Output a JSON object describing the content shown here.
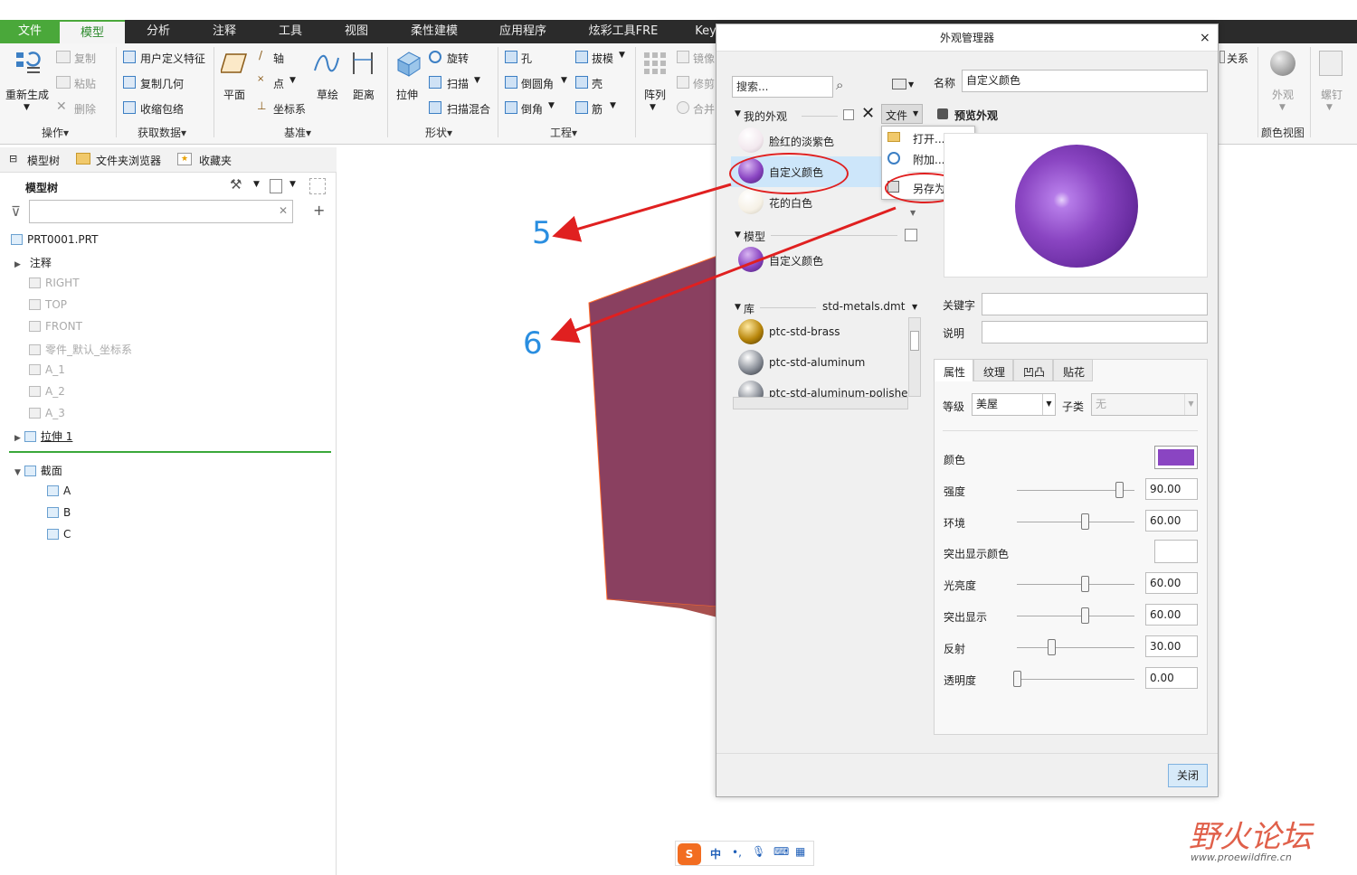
{
  "tabs": {
    "file": "文件",
    "model": "模型",
    "analysis": "分析",
    "annotate": "注释",
    "tools": "工具",
    "view": "视图",
    "flexible": "柔性建模",
    "apps": "应用程序",
    "fancy": "炫彩工具FRE",
    "key": "Key"
  },
  "ribbon": {
    "regen": "重新生成",
    "copy": "复制",
    "paste": "粘贴",
    "delete": "删除",
    "operations": "操作▾",
    "udf": "用户定义特征",
    "copy_geom": "复制几何",
    "shrinkwrap": "收缩包络",
    "get_data": "获取数据▾",
    "plane": "平面",
    "axis": "轴",
    "point": "点",
    "csys": "坐标系",
    "sketch": "草绘",
    "distance": "距离",
    "datum": "基准▾",
    "extrude": "拉伸",
    "revolve": "旋转",
    "sweep": "扫描",
    "swept_blend": "扫描混合",
    "shapes": "形状▾",
    "hole": "孔",
    "draft": "拔模",
    "round": "倒圆角",
    "shell": "壳",
    "chamfer": "倒角",
    "rib": "筋",
    "engineering": "工程▾",
    "pattern": "阵列",
    "mirror": "镜像",
    "trim": "修剪",
    "merge": "合并",
    "relations": "关系",
    "appearance": "外观",
    "color_view": "颜色视图",
    "thread": "螺钉"
  },
  "left": {
    "tab_model_tree": "模型树",
    "tab_folder": "文件夹浏览器",
    "tab_fav": "收藏夹",
    "tree_title": "模型树",
    "items": [
      {
        "label": "PRT0001.PRT"
      },
      {
        "label": "注释"
      },
      {
        "label": "RIGHT"
      },
      {
        "label": "TOP"
      },
      {
        "label": "FRONT"
      },
      {
        "label": "零件_默认_坐标系"
      },
      {
        "label": "A_1"
      },
      {
        "label": "A_2"
      },
      {
        "label": "A_3"
      },
      {
        "label": "拉伸 1"
      }
    ],
    "sections": {
      "title": "截面",
      "a": "A",
      "b": "B",
      "c": "C"
    }
  },
  "canvas": {
    "arrow5": "5",
    "arrow6": "6"
  },
  "dialog": {
    "title": "外观管理器",
    "search_placeholder": "搜索...",
    "name_label": "名称",
    "name_value": "自定义颜色",
    "my_appearances": "我的外观",
    "file_btn": "文件",
    "preview": "预览外观",
    "my_items": [
      {
        "label": "脸红的淡紫色"
      },
      {
        "label": "自定义颜色"
      },
      {
        "label": "花的白色"
      }
    ],
    "model_section": "模型",
    "model_items": [
      {
        "label": "自定义颜色"
      }
    ],
    "lib_section": "库",
    "lib_file": "std-metals.dmt",
    "lib_items": [
      {
        "label": "ptc-std-brass"
      },
      {
        "label": "ptc-std-aluminum"
      },
      {
        "label": "ptc-std-aluminum-polished"
      }
    ],
    "menu": {
      "open": "打开...",
      "append": "附加...",
      "save_as": "另存为..."
    },
    "keyword": "关键字",
    "description": "说明",
    "tabs": {
      "props": "属性",
      "texture": "纹理",
      "bump": "凹凸",
      "decal": "贴花"
    },
    "class_label": "等级",
    "class_value": "美屋",
    "subclass_label": "子类",
    "subclass_value": "无",
    "color_label": "颜色",
    "color_hex": "#8a45c2",
    "props": [
      {
        "label": "强度",
        "value": "90.00",
        "frac": 0.9
      },
      {
        "label": "环境",
        "value": "60.00",
        "frac": 0.6
      },
      {
        "label": "光亮度",
        "value": "60.00",
        "frac": 0.6
      },
      {
        "label": "突出显示",
        "value": "60.00",
        "frac": 0.6
      },
      {
        "label": "反射",
        "value": "30.00",
        "frac": 0.3
      },
      {
        "label": "透明度",
        "value": "0.00",
        "frac": 0.0
      }
    ],
    "highlight_color": "突出显示颜色",
    "close": "关闭"
  },
  "ime": {
    "label": "中"
  },
  "watermark": {
    "text": "野火论坛",
    "url": "www.proewildfire.cn"
  },
  "colors": {
    "purple": "#8a45c2",
    "green": "#4aa83a",
    "red": "#e02020",
    "blue": "#2a8ee0"
  }
}
